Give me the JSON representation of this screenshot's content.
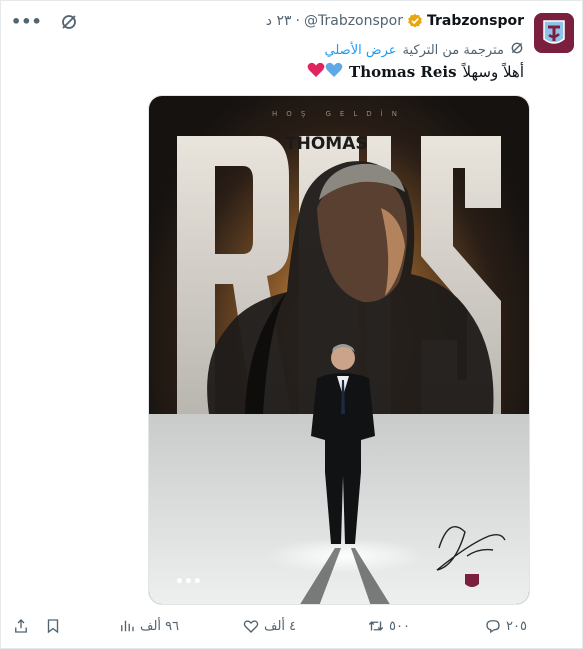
{
  "account": {
    "name": "Trabzonspor",
    "handle": "@Trabzonspor",
    "time": "٢٣ د",
    "separator": "·"
  },
  "translation": {
    "note": "مترجمة من التركية",
    "show_original": "عرض الأصلي"
  },
  "tweet": {
    "greeting": "أهلاً وسهلاً",
    "coach_name": "Thomas Reis",
    "emojis": "❤️💙"
  },
  "media": {
    "poster_top_text": "HOŞ GELDİN",
    "poster_first_name": "THOMAS",
    "poster_last_name": "REIS"
  },
  "actions": {
    "replies": "٢٠٥",
    "retweets": "٥٠٠",
    "likes": "٤ ألف",
    "views": "٩٦ ألف"
  },
  "colors": {
    "accent": "#1d9bf0",
    "verified": "#e8a50e",
    "like_heart": "#e0245e",
    "blue_heart": "#5fa9e6"
  },
  "icons": {
    "more": "ellipsis-icon",
    "grok": "grok-icon",
    "verified": "verified-badge-icon",
    "reply": "reply-icon",
    "retweet": "retweet-icon",
    "like": "like-icon",
    "views": "views-icon",
    "bookmark": "bookmark-icon",
    "share": "share-icon"
  }
}
